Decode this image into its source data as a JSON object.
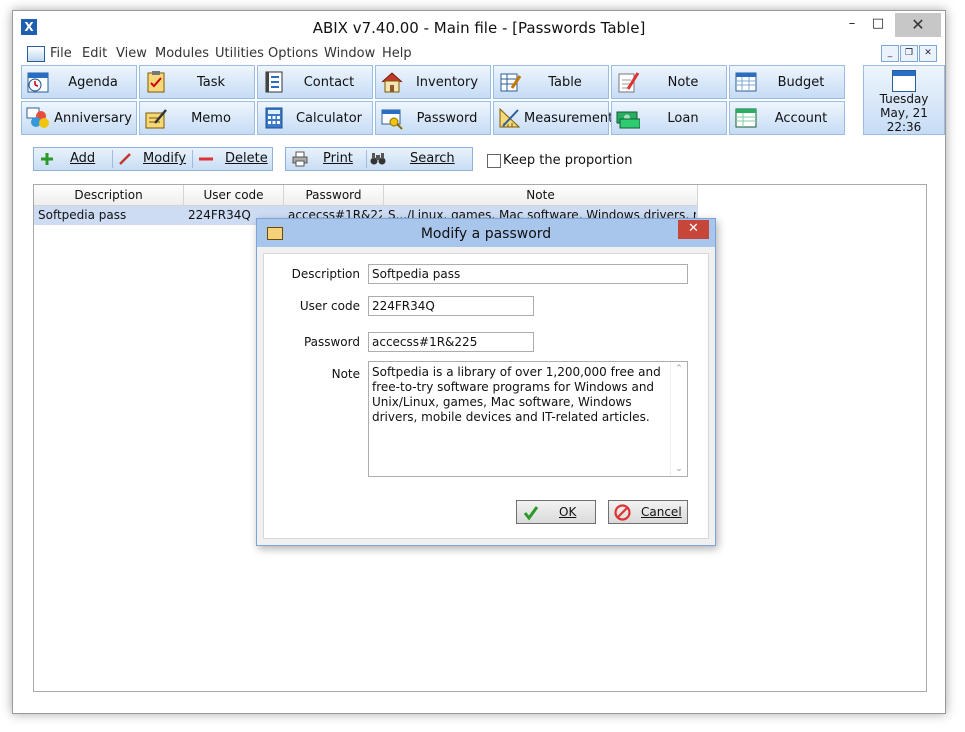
{
  "window": {
    "title": "ABIX v7.40.00  -  Main file - [Passwords Table]",
    "minimize": "–",
    "maximize": "□",
    "close": "✕"
  },
  "menu": {
    "items": [
      "File",
      "Edit",
      "View",
      "Modules",
      "Utilities",
      "Options",
      "Window",
      "Help"
    ]
  },
  "mdi": {
    "minimize": "_",
    "restore": "❐",
    "close": "✕"
  },
  "modules": {
    "row1": [
      "Agenda",
      "Task",
      "Contact",
      "Inventory",
      "Table",
      "Note",
      "Budget"
    ],
    "row2": [
      "Anniversary",
      "Memo",
      "Calculator",
      "Password",
      "Measurement",
      "Loan",
      "Account"
    ]
  },
  "datebox": {
    "day": "Tuesday",
    "date": "May, 21",
    "time": "22:36"
  },
  "toolbar": {
    "add": "Add",
    "modify": "Modify",
    "delete": "Delete",
    "print": "Print",
    "search": "Search",
    "keep_proportion": "Keep the proportion"
  },
  "table": {
    "columns": [
      "Description",
      "User code",
      "Password",
      "Note"
    ],
    "rows": [
      {
        "description": "Softpedia pass",
        "user_code": "224FR34Q",
        "password": "accecss#1R&225",
        "note": "S.../Linux, games, Mac software, Windows drivers, mobile devices"
      }
    ]
  },
  "dialog": {
    "title": "Modify a password",
    "close": "✕",
    "fields": {
      "description_label": "Description",
      "description": "Softpedia pass",
      "user_code_label": "User code",
      "user_code": "224FR34Q",
      "password_label": "Password",
      "password": "accecss#1R&225",
      "note_label": "Note",
      "note": "Softpedia is a library of over 1,200,000 free and free-to-try software programs for Windows and Unix/Linux, games, Mac software, Windows drivers, mobile devices and IT-related articles."
    },
    "ok": "OK",
    "cancel": "Cancel"
  }
}
